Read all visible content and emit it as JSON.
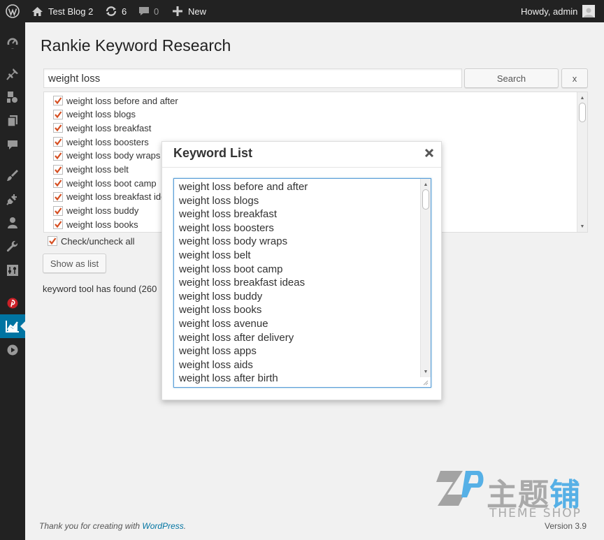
{
  "adminbar": {
    "site_name": "Test Blog 2",
    "updates_count": "6",
    "comments_count": "0",
    "new_label": "New",
    "howdy": "Howdy, admin"
  },
  "sidebar": {
    "items": [
      {
        "name": "dashboard-icon"
      },
      {
        "name": "posts-pin-icon"
      },
      {
        "name": "media-icon"
      },
      {
        "name": "pages-icon"
      },
      {
        "name": "comments-icon"
      },
      {
        "name": "appearance-brush-icon"
      },
      {
        "name": "plugins-icon"
      },
      {
        "name": "users-icon"
      },
      {
        "name": "tools-wrench-icon"
      },
      {
        "name": "settings-icon"
      },
      {
        "name": "pinterest-icon"
      },
      {
        "name": "rankie-chart-icon",
        "current": true
      },
      {
        "name": "play-icon"
      }
    ]
  },
  "page": {
    "title": "Rankie Keyword Research",
    "search_value": "weight loss",
    "search_button": "Search",
    "clear_button": "x",
    "keywords": [
      "weight loss before and after",
      "weight loss blogs",
      "weight loss breakfast",
      "weight loss boosters",
      "weight loss body wraps",
      "weight loss belt",
      "weight loss boot camp",
      "weight loss breakfast ideas",
      "weight loss buddy",
      "weight loss books"
    ],
    "check_all": "Check/uncheck all",
    "show_list_button": "Show as list",
    "status_text": "keyword tool has found (260"
  },
  "modal": {
    "title": "Keyword List",
    "lines": [
      "weight loss before and after",
      "weight loss blogs",
      "weight loss breakfast",
      "weight loss boosters",
      "weight loss body wraps",
      "weight loss belt",
      "weight loss boot camp",
      "weight loss breakfast ideas",
      "weight loss buddy",
      "weight loss books",
      "weight loss avenue",
      "weight loss after delivery",
      "weight loss apps",
      "weight loss aids",
      "weight loss after birth"
    ]
  },
  "footer": {
    "thanks_prefix": "Thank you for creating with ",
    "thanks_link": "WordPress",
    "thanks_suffix": ".",
    "version": "Version 3.9"
  },
  "watermark": {
    "cn_gray": "主题",
    "cn_blue": "铺",
    "en": "THEME SHOP"
  },
  "colors": {
    "adminbar_bg": "#222222",
    "accent": "#0074a2",
    "checkbox_orange": "#d54e21"
  }
}
